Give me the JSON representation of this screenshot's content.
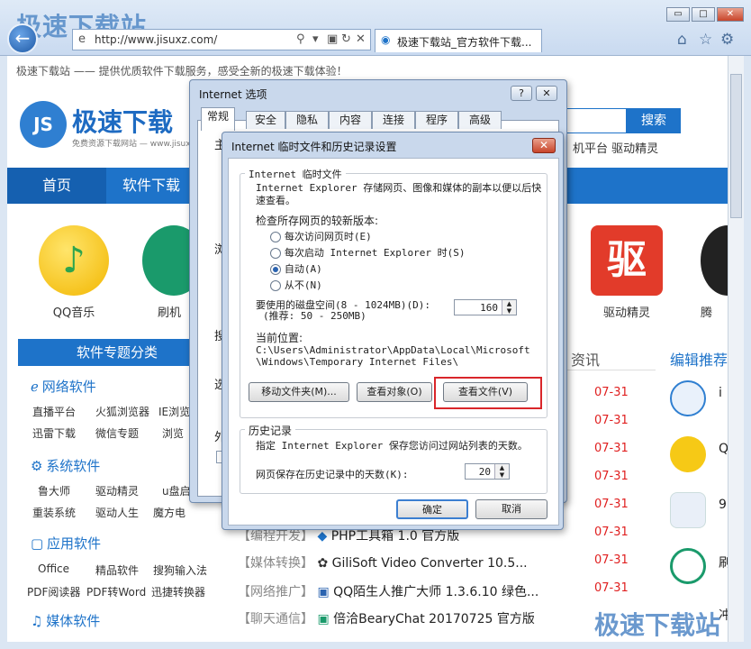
{
  "browser": {
    "watermark": "极速下载站",
    "url": "http://www.jisuxz.com/",
    "tab_title": "极速下载站_官方软件下载...",
    "win_minimize": "▭",
    "win_maximize": "□",
    "win_close": "✕"
  },
  "page": {
    "top_note": "极速下载站 —— 提供优质软件下载服务，感受全新的极速下载体验！",
    "logo_badge": "JS",
    "logo_text": "极速下载",
    "logo_sub": "免费资源下载网站 — www.jisux",
    "search_button": "搜索",
    "hotlinks": "机平台  驱动精灵",
    "nav": [
      "首页",
      "软件下载"
    ],
    "apps": [
      {
        "label": "QQ音乐",
        "color": "#f6c916"
      },
      {
        "label": "刷机",
        "color": "#1a9a6b"
      },
      {
        "label": "驱动精灵",
        "color": "#e23b2a",
        "glyph": "驱"
      },
      {
        "label": "腾",
        "color": "#222"
      }
    ],
    "sidebar_head": "软件专题分类",
    "categories": [
      {
        "title": "网络软件",
        "rows": [
          "直播平台",
          "火狐浏览器",
          "IE浏览",
          "迅雷下载",
          "微信专题",
          "浏览"
        ]
      },
      {
        "title": "系统软件",
        "rows": [
          "鲁大师",
          "驱动精灵",
          "u盘启",
          "重装系统",
          "驱动人生",
          "魔方电"
        ]
      },
      {
        "title": "应用软件",
        "rows": [
          "Office",
          "精品软件",
          "搜狗输入法",
          "PDF阅读器",
          "PDF转Word",
          "迅捷转换器"
        ]
      },
      {
        "title": "媒体软件",
        "rows": []
      }
    ],
    "news_head": "资讯",
    "dates": [
      "07-31",
      "07-31",
      "07-31",
      "07-31",
      "07-31",
      "07-31",
      "07-31",
      "07-31"
    ],
    "list": [
      {
        "tag": "【编程开发】",
        "name": "PHP工具箱 1.0 官方版"
      },
      {
        "tag": "【媒体转换】",
        "name": "GiliSoft Video Converter 10.5..."
      },
      {
        "tag": "【网络推广】",
        "name": "QQ陌生人推广大师 1.3.6.10 绿色..."
      },
      {
        "tag": "【聊天通信】",
        "name": "倍洽BearyChat 20170725 官方版"
      }
    ],
    "edit_head": "编辑推荐",
    "edit_items": [
      "i",
      "Q",
      "9",
      "刷",
      "冲"
    ],
    "bottom_watermark": "极速下载站"
  },
  "ie_options": {
    "title": "Internet 选项",
    "help": "?",
    "close": "✕",
    "tabs": [
      "常规",
      "安全",
      "隐私",
      "内容",
      "连接",
      "程序",
      "高级"
    ],
    "side_letters": [
      "主",
      "浏",
      "搜",
      "选",
      "外"
    ]
  },
  "temp_dialog": {
    "title": "Internet 临时文件和历史记录设置",
    "close": "✕",
    "group1_title": "Internet 临时文件",
    "desc": "Internet Explorer 存储网页、图像和媒体的副本以便以后快速查看。",
    "check_label": "检查所存网页的较新版本:",
    "options": [
      "每次访问网页时(E)",
      "每次启动 Internet Explorer 时(S)",
      "自动(A)",
      "从不(N)"
    ],
    "selected_option": 2,
    "disk_label": "要使用的磁盘空间(8 - 1024MB)(D):",
    "disk_hint": "(推荐: 50 - 250MB)",
    "disk_value": "160",
    "location_label": "当前位置:",
    "location_path": "C:\\Users\\Administrator\\AppData\\Local\\Microsoft\\Windows\\Temporary Internet Files\\",
    "btn_move": "移动文件夹(M)...",
    "btn_objects": "查看对象(O)",
    "btn_files": "查看文件(V)",
    "group2_title": "历史记录",
    "history_desc": "指定 Internet Explorer 保存您访问过网站列表的天数。",
    "days_label": "网页保存在历史记录中的天数(K):",
    "days_value": "20",
    "ok": "确定",
    "cancel": "取消",
    "highlight_color": "#d9262a"
  }
}
